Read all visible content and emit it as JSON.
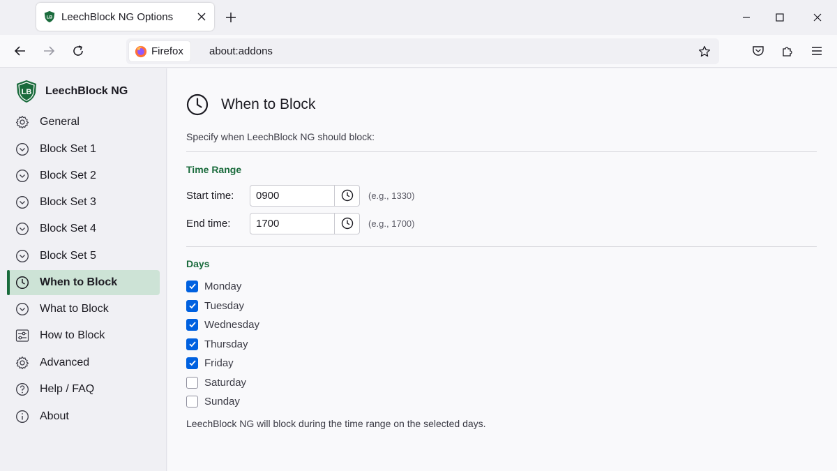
{
  "browser": {
    "tab_title": "LeechBlock NG Options",
    "identity_label": "Firefox",
    "url": "about:addons"
  },
  "sidebar": {
    "brand": "LeechBlock NG",
    "logo_text": "LB",
    "items": [
      {
        "label": "General",
        "icon": "gear-icon"
      },
      {
        "label": "Block Set 1",
        "icon": "chevron-circle-icon"
      },
      {
        "label": "Block Set 2",
        "icon": "chevron-circle-icon"
      },
      {
        "label": "Block Set 3",
        "icon": "chevron-circle-icon"
      },
      {
        "label": "Block Set 4",
        "icon": "chevron-circle-icon"
      },
      {
        "label": "Block Set 5",
        "icon": "chevron-circle-icon"
      },
      {
        "label": "When to Block",
        "icon": "clock-icon",
        "active": true
      },
      {
        "label": "What to Block",
        "icon": "chevron-circle-icon"
      },
      {
        "label": "How to Block",
        "icon": "sliders-icon"
      },
      {
        "label": "Advanced",
        "icon": "gear-icon"
      },
      {
        "label": "Help / FAQ",
        "icon": "question-icon"
      },
      {
        "label": "About",
        "icon": "info-icon"
      }
    ]
  },
  "main": {
    "title": "When to Block",
    "subtitle": "Specify when LeechBlock NG should block:",
    "time_range": {
      "heading": "Time Range",
      "start": {
        "label": "Start time:",
        "value": "0900",
        "hint": "(e.g., 1330)"
      },
      "end": {
        "label": "End time:",
        "value": "1700",
        "hint": "(e.g., 1700)"
      }
    },
    "days": {
      "heading": "Days",
      "items": [
        {
          "label": "Monday",
          "checked": true
        },
        {
          "label": "Tuesday",
          "checked": true
        },
        {
          "label": "Wednesday",
          "checked": true
        },
        {
          "label": "Thursday",
          "checked": true
        },
        {
          "label": "Friday",
          "checked": true
        },
        {
          "label": "Saturday",
          "checked": false
        },
        {
          "label": "Sunday",
          "checked": false
        }
      ]
    },
    "footnote": "LeechBlock NG will block during the time range on the selected days."
  },
  "colors": {
    "accent_green": "#1a6b3c",
    "active_bg": "#cde3d6",
    "checkbox_blue": "#0061e0"
  }
}
